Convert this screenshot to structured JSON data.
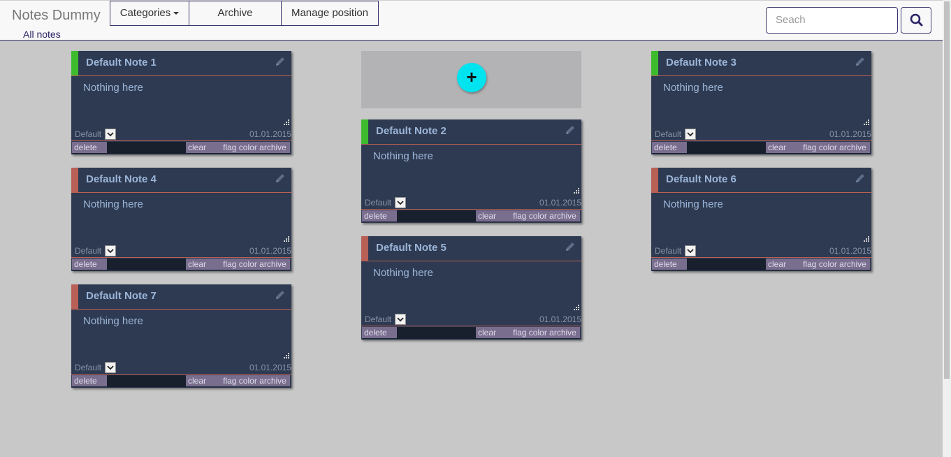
{
  "app": {
    "brand": "Notes Dummy",
    "all_notes": "All notes",
    "menu": {
      "categories": "Categories",
      "archive": "Archive",
      "manage_position": "Manage position"
    },
    "search": {
      "placeholder": "Seach"
    }
  },
  "add_button": "+",
  "colors": {
    "green_flag": "#3dbb2d",
    "red_flag": "#b85f56",
    "note_bg": "#2e3a51",
    "accent": "#00e4f0"
  },
  "notes": [
    {
      "title": "Default Note 1",
      "body": "Nothing here",
      "category": "Default",
      "date": "01.01.2015",
      "flag": "green",
      "actions": {
        "delete": "delete",
        "clear": "clear",
        "flag_color": "flag color",
        "archive": "archive"
      }
    },
    {
      "title": "Default Note 2",
      "body": "Nothing here",
      "category": "Default",
      "date": "01.01.2015",
      "flag": "green",
      "actions": {
        "delete": "delete",
        "clear": "clear",
        "flag_color": "flag color",
        "archive": "archive"
      }
    },
    {
      "title": "Default Note 3",
      "body": "Nothing here",
      "category": "Default",
      "date": "01.01.2015",
      "flag": "green",
      "actions": {
        "delete": "delete",
        "clear": "clear",
        "flag_color": "flag color",
        "archive": "archive"
      }
    },
    {
      "title": "Default Note 4",
      "body": "Nothing here",
      "category": "Default",
      "date": "01.01.2015",
      "flag": "red",
      "actions": {
        "delete": "delete",
        "clear": "clear",
        "flag_color": "flag color",
        "archive": "archive"
      }
    },
    {
      "title": "Default Note 5",
      "body": "Nothing here",
      "category": "Default",
      "date": "01.01.2015",
      "flag": "red",
      "actions": {
        "delete": "delete",
        "clear": "clear",
        "flag_color": "flag color",
        "archive": "archive"
      }
    },
    {
      "title": "Default Note 6",
      "body": "Nothing here",
      "category": "Default",
      "date": "01.01.2015",
      "flag": "red",
      "actions": {
        "delete": "delete",
        "clear": "clear",
        "flag_color": "flag color",
        "archive": "archive"
      }
    },
    {
      "title": "Default Note 7",
      "body": "Nothing here",
      "category": "Default",
      "date": "01.01.2015",
      "flag": "red",
      "actions": {
        "delete": "delete",
        "clear": "clear",
        "flag_color": "flag color",
        "archive": "archive"
      }
    }
  ]
}
